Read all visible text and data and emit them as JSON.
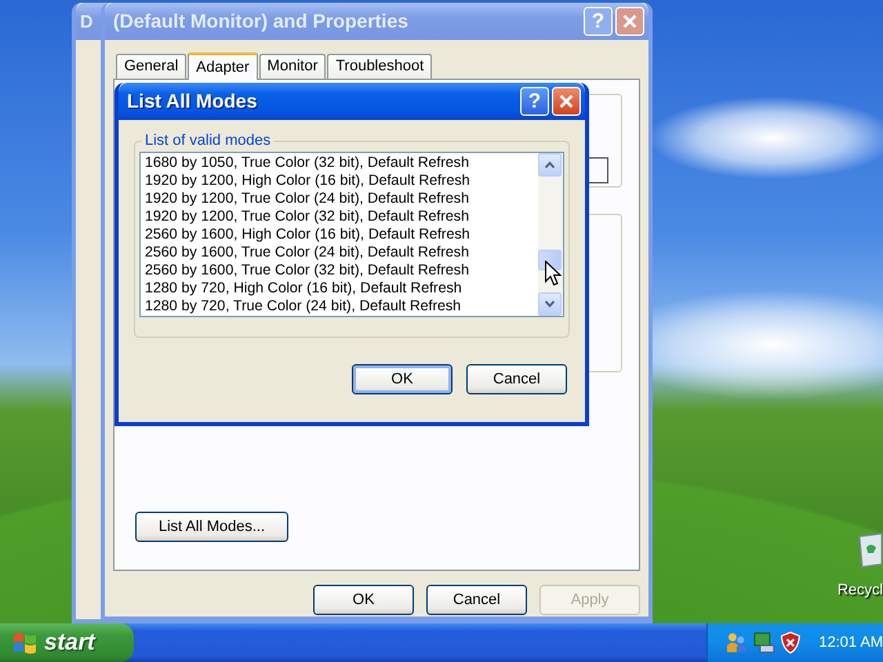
{
  "desktop": {
    "icons": [
      {
        "label": "Recycl"
      }
    ]
  },
  "back_window": {
    "title": "D"
  },
  "properties_window": {
    "title": "(Default Monitor) and  Properties",
    "help": "?",
    "tabs": [
      {
        "label": "General",
        "selected": false
      },
      {
        "label": "Adapter",
        "selected": true
      },
      {
        "label": "Monitor",
        "selected": false
      },
      {
        "label": "Troubleshoot",
        "selected": false
      }
    ],
    "list_all_modes_button": "List All Modes...",
    "buttons": [
      {
        "label": "OK",
        "disabled": false
      },
      {
        "label": "Cancel",
        "disabled": false
      },
      {
        "label": "Apply",
        "disabled": true
      }
    ]
  },
  "modes_dialog": {
    "title": "List All Modes",
    "help": "?",
    "group_label": "List of valid modes",
    "modes": [
      {
        "label": "1680 by 1050, True Color (32 bit), Default Refresh",
        "selected": false
      },
      {
        "label": "1920 by 1200, High Color (16 bit), Default Refresh",
        "selected": false
      },
      {
        "label": "1920 by 1200, True Color (24 bit), Default Refresh",
        "selected": false
      },
      {
        "label": "1920 by 1200, True Color (32 bit), Default Refresh",
        "selected": false
      },
      {
        "label": "2560 by 1600, High Color (16 bit), Default Refresh",
        "selected": false
      },
      {
        "label": "2560 by 1600, True Color (24 bit), Default Refresh",
        "selected": false
      },
      {
        "label": "2560 by 1600, True Color (32 bit), Default Refresh",
        "selected": false
      },
      {
        "label": "1280 by 720, High Color (16 bit), Default Refresh",
        "selected": false
      },
      {
        "label": "1280 by 720, True Color (24 bit), Default Refresh",
        "selected": false
      }
    ],
    "buttons": [
      {
        "label": "OK",
        "default": true
      },
      {
        "label": "Cancel",
        "default": false
      }
    ]
  },
  "taskbar": {
    "start_label": "start",
    "clock": "12:01 AM"
  }
}
